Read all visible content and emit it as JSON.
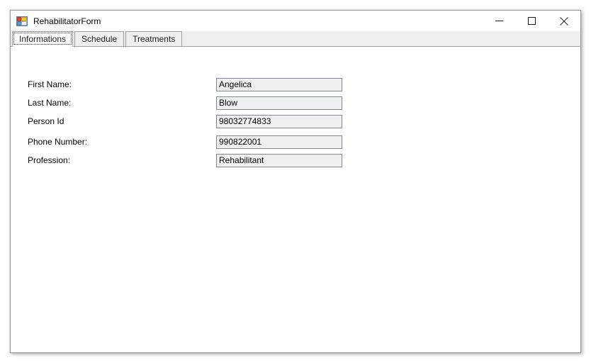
{
  "window": {
    "title": "RehabilitatorForm",
    "icon": "winforms-app-icon",
    "controls": {
      "minimize_label": "Minimize",
      "maximize_label": "Maximize",
      "close_label": "Close",
      "minimize_icon": "minimize-icon",
      "maximize_icon": "maximize-icon",
      "close_icon": "close-icon"
    }
  },
  "tabs": {
    "selected_index": 0,
    "items": [
      {
        "label": "Informations",
        "selected": true
      },
      {
        "label": "Schedule",
        "selected": false
      },
      {
        "label": "Treatments",
        "selected": false
      }
    ]
  },
  "form": {
    "fields": [
      {
        "label": "First Name:",
        "value": "Angelica",
        "name": "first-name"
      },
      {
        "label": "Last Name:",
        "value": "Blow",
        "name": "last-name"
      },
      {
        "label": "Person Id",
        "value": "98032774833",
        "name": "person-id"
      },
      {
        "label": "Phone Number:",
        "value": "990822001",
        "name": "phone-number"
      },
      {
        "label": "Profession:",
        "value": "Rehabilitant",
        "name": "profession"
      }
    ]
  },
  "colors": {
    "window_border": "#9a9a9a",
    "tabstrip_bg": "#efefef",
    "tab_border": "#a0a0a0",
    "field_bg": "#efefef",
    "field_border": "#828790",
    "content_bg": "#ffffff",
    "text": "#000000"
  }
}
